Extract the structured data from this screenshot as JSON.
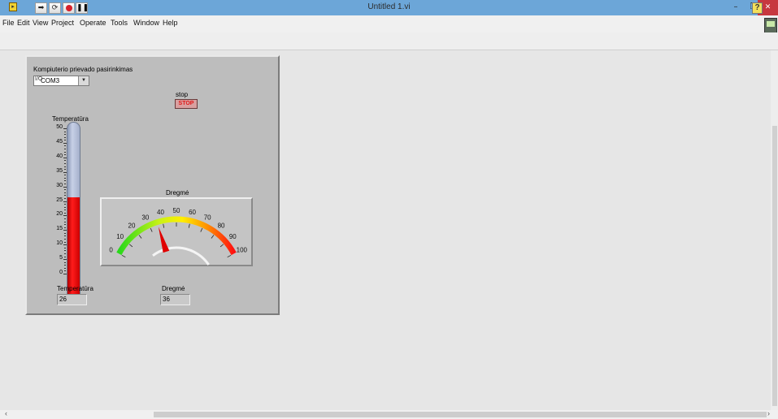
{
  "window": {
    "title": "Untitled 1.vi"
  },
  "menu": [
    "File",
    "Edit",
    "View",
    "Project",
    "Operate",
    "Tools",
    "Window",
    "Help"
  ],
  "toolbar": {
    "help_glyph": "?"
  },
  "panel": {
    "port_label": "Kompiuterio prievado pasirinkimas",
    "port_prefix": "I/O",
    "port_value": "COM3",
    "stop_label": "stop",
    "stop_button_text": "STOP",
    "thermometer": {
      "label": "Temperatūra",
      "scale": [
        0,
        5,
        10,
        15,
        20,
        25,
        30,
        35,
        40,
        45,
        50
      ],
      "min": 0,
      "max": 50,
      "value": 26
    },
    "gauge": {
      "label": "Dregmė",
      "scale": [
        0,
        10,
        20,
        30,
        40,
        50,
        60,
        70,
        80,
        90,
        100
      ],
      "min": 0,
      "max": 100,
      "value": 36
    },
    "temp_indicator": {
      "label": "Temperatūra",
      "value": "26"
    },
    "humidity_indicator": {
      "label": "Dregmė",
      "value": "36"
    }
  },
  "colors": {
    "titlebar": "#6ca6d8",
    "close": "#c7383f",
    "panel": "#bdbdbd",
    "mercury": "#ff1c1c"
  }
}
